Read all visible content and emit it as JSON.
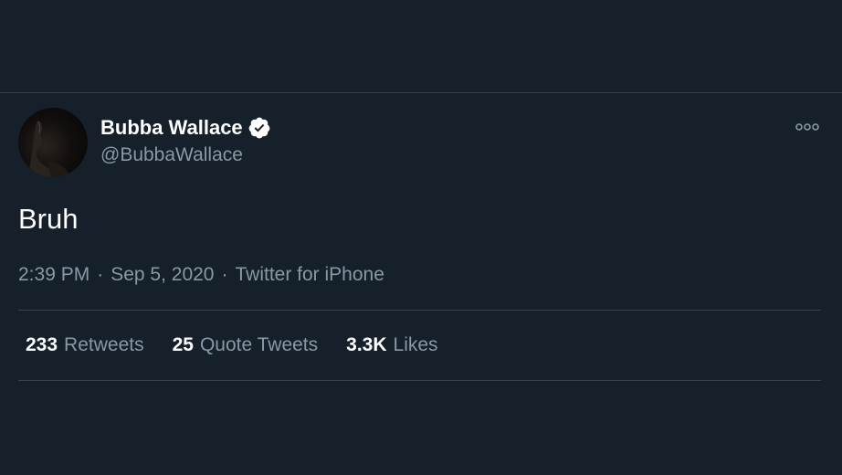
{
  "user": {
    "display_name": "Bubba Wallace",
    "handle": "@BubbaWallace",
    "verified": true
  },
  "tweet": {
    "text": "Bruh",
    "time": "2:39 PM",
    "date": "Sep 5, 2020",
    "source": "Twitter for iPhone",
    "separator": "·"
  },
  "stats": [
    {
      "count": "233",
      "label": "Retweets"
    },
    {
      "count": "25",
      "label": "Quote Tweets"
    },
    {
      "count": "3.3K",
      "label": "Likes"
    }
  ],
  "icons": {
    "more": "more-options-icon",
    "verified": "verified-badge-icon"
  },
  "colors": {
    "background": "#15202b",
    "primary_text": "#ffffff",
    "secondary_text": "#8899a6",
    "divider": "#38444d"
  }
}
